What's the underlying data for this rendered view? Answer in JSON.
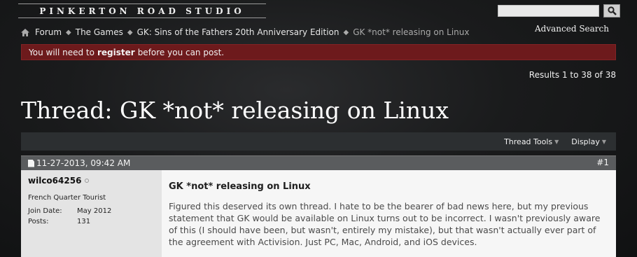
{
  "site": {
    "logo_text": "PINKERTON ROAD STUDIO",
    "advanced_search": "Advanced Search",
    "search_icon": "magnifier-icon"
  },
  "breadcrumb": {
    "home_icon": "home-icon",
    "items": [
      "Forum",
      "The Games",
      "GK: Sins of the Fathers 20th Anniversary Edition"
    ],
    "current": "GK *not* releasing on Linux"
  },
  "notice": {
    "prefix": "You will need to",
    "link": "register",
    "suffix": "before you can post."
  },
  "results": "Results 1 to 38 of 38",
  "thread": {
    "title": "Thread: GK *not* releasing on Linux"
  },
  "toolbar": {
    "thread_tools": "Thread Tools",
    "display": "Display"
  },
  "post": {
    "date": "11-27-2013, 09:42 AM",
    "number": "#1",
    "username": "wilco64256",
    "user_title": "French Quarter Tourist",
    "join_date_label": "Join Date:",
    "join_date": "May 2012",
    "posts_label": "Posts:",
    "posts": "131",
    "title": "GK *not* releasing on Linux",
    "body": "Figured this deserved its own thread. I hate to be the bearer of bad news here, but my previous statement that GK would be available on Linux turns out to be incorrect. I wasn't previously aware of this (I should have been, but wasn't, entirely my mistake), but that wasn't actually ever part of the agreement with Activision. Just PC, Mac, Android, and iOS devices."
  },
  "colors": {
    "notice_bg": "#6d1a1c",
    "post_header_bg": "#5a5c5e",
    "userinfo_bg": "#e4e4e4",
    "postbody_bg": "#f6f6f6"
  }
}
